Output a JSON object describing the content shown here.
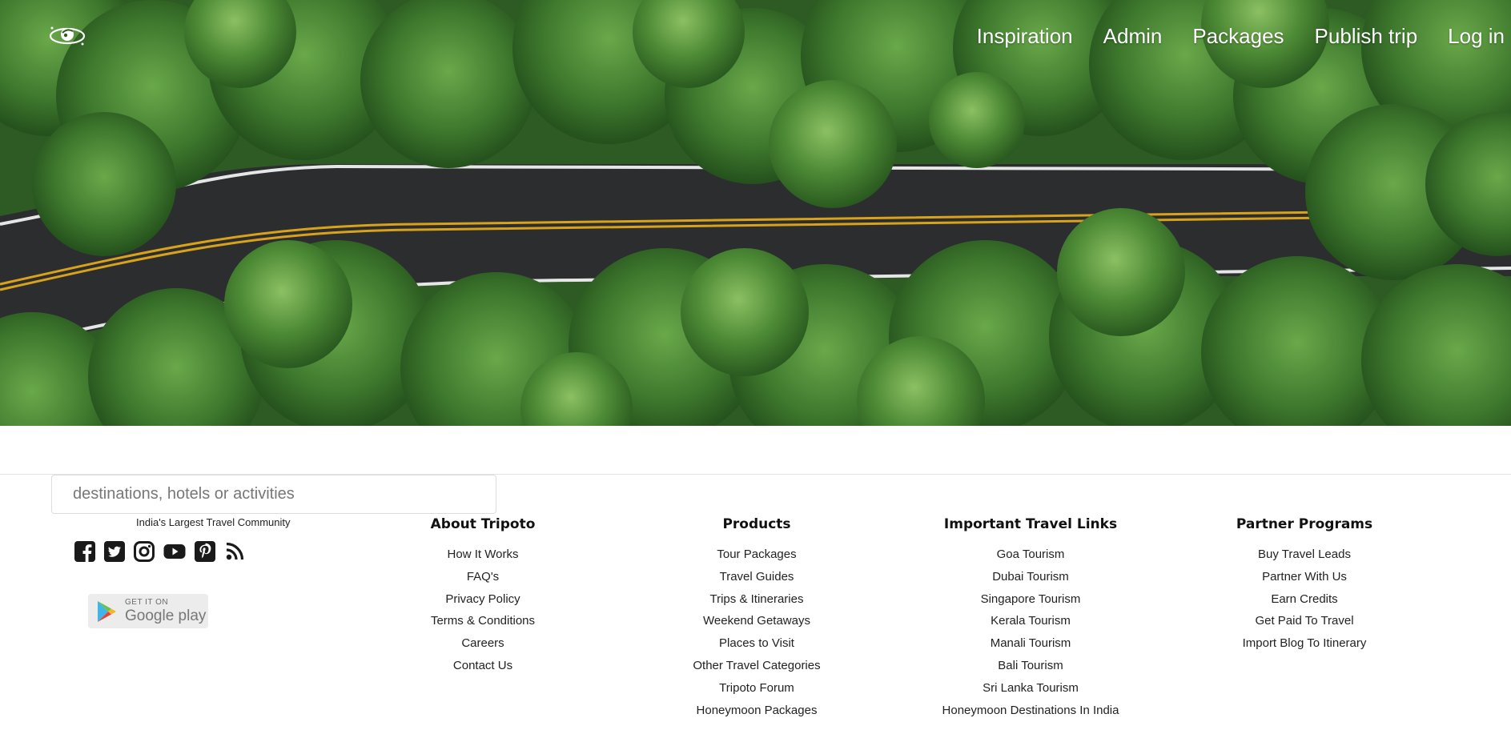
{
  "hero": {
    "nav": [
      "Inspiration",
      "Admin",
      "Packages",
      "Publish trip",
      "Log in"
    ]
  },
  "search": {
    "placeholder": "destinations, hotels or activities"
  },
  "tagline": "India's Largest Travel Community",
  "social_icons": [
    "facebook-icon",
    "twitter-icon",
    "instagram-icon",
    "youtube-icon",
    "pinterest-icon",
    "rss-icon"
  ],
  "google_play": {
    "line1": "GET IT ON",
    "line2": "Google play"
  },
  "columns": [
    {
      "title": "About Tripoto",
      "links": [
        "How It Works",
        "FAQ's",
        "Privacy Policy",
        "Terms & Conditions",
        "Careers",
        "Contact Us"
      ]
    },
    {
      "title": "Products",
      "links": [
        "Tour Packages",
        "Travel Guides",
        "Trips & Itineraries",
        "Weekend Getaways",
        "Places to Visit",
        "Other Travel Categories",
        "Tripoto Forum",
        "Honeymoon Packages"
      ]
    },
    {
      "title": "Important Travel Links",
      "links": [
        "Goa Tourism",
        "Dubai Tourism",
        "Singapore Tourism",
        "Kerala Tourism",
        "Manali Tourism",
        "Bali Tourism",
        "Sri Lanka Tourism",
        "Honeymoon Destinations In India"
      ]
    },
    {
      "title": "Partner Programs",
      "links": [
        "Buy Travel Leads",
        "Partner With Us",
        "Earn Credits",
        "Get Paid To Travel",
        "Import Blog To Itinerary"
      ]
    }
  ],
  "colors": {
    "road": "#2b2d2f",
    "foliage": "#3f7a2e",
    "road_line": "#d8a21b"
  }
}
